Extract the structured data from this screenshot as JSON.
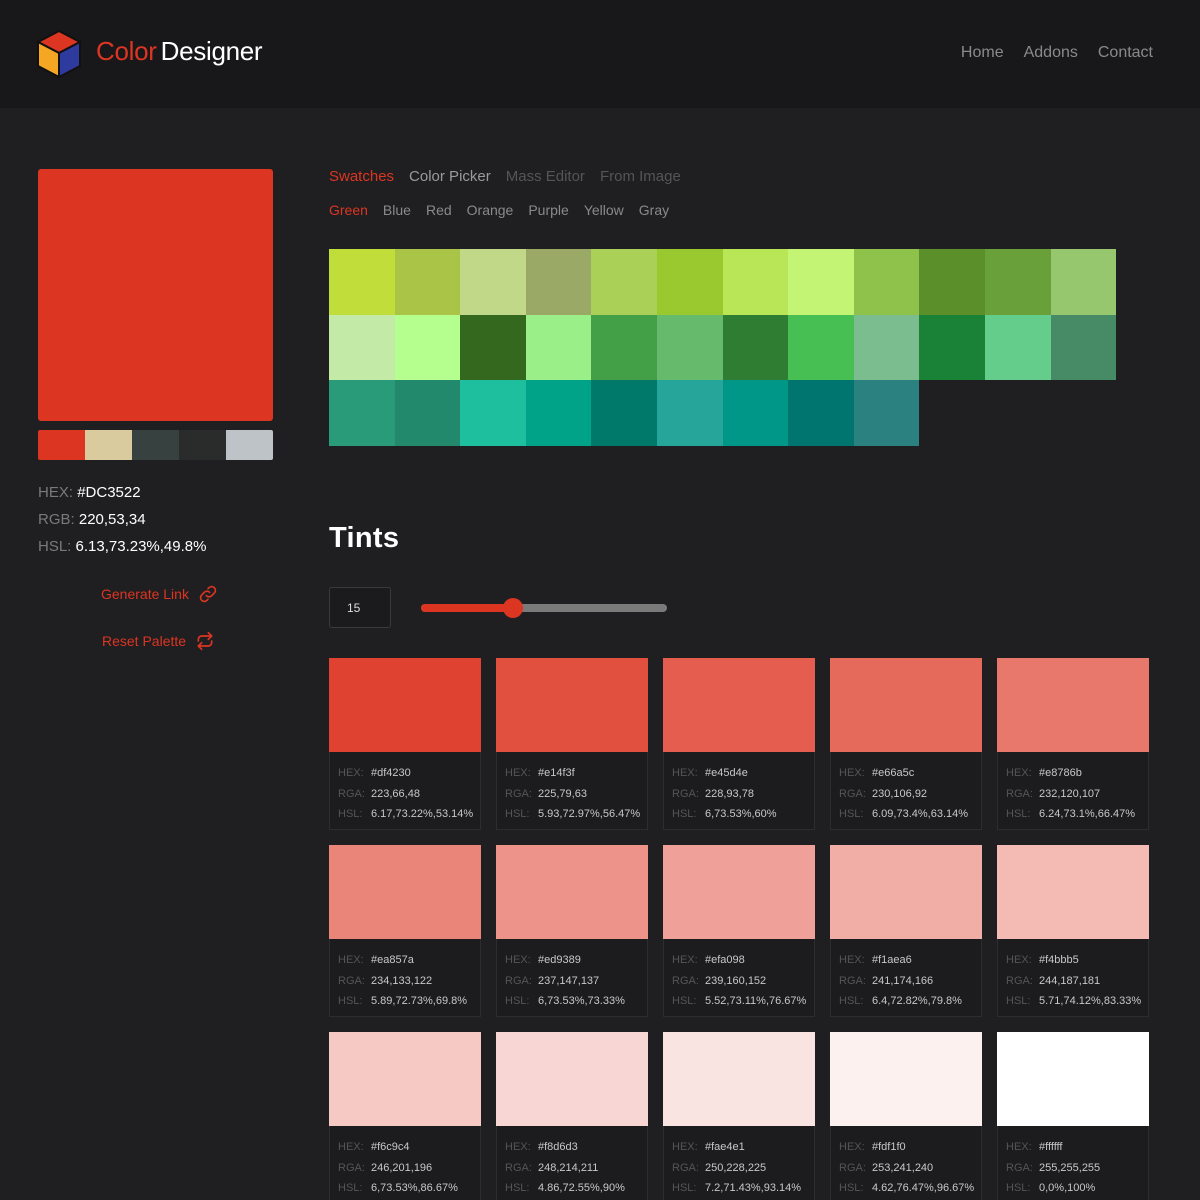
{
  "header": {
    "logo_icon": "cube-logo-icon",
    "brand_part1": "Color",
    "brand_part2": "Designer",
    "nav": [
      {
        "label": "Home"
      },
      {
        "label": "Addons"
      },
      {
        "label": "Contact"
      }
    ]
  },
  "current_color": {
    "hex": "#DC3522",
    "swatch_color": "#dc3522",
    "hex_label": "HEX:",
    "rgb_label": "RGB:",
    "rgb": "220,53,34",
    "hsl_label": "HSL:",
    "hsl": "6.13,73.23%,49.8%"
  },
  "palette": [
    "#dc3522",
    "#d9cb9e",
    "#374140",
    "#2a2c2b",
    "#bdc3c7"
  ],
  "actions": {
    "generate_link": "Generate Link",
    "generate_link_icon": "link-icon",
    "reset_palette": "Reset Palette",
    "reset_palette_icon": "repeat-icon"
  },
  "tabs": [
    {
      "label": "Swatches",
      "state": "active"
    },
    {
      "label": "Color Picker",
      "state": "normal"
    },
    {
      "label": "Mass Editor",
      "state": "disabled"
    },
    {
      "label": "From Image",
      "state": "disabled"
    }
  ],
  "subtabs": [
    {
      "label": "Green",
      "active": true
    },
    {
      "label": "Blue",
      "active": false
    },
    {
      "label": "Red",
      "active": false
    },
    {
      "label": "Orange",
      "active": false
    },
    {
      "label": "Purple",
      "active": false
    },
    {
      "label": "Yellow",
      "active": false
    },
    {
      "label": "Gray",
      "active": false
    }
  ],
  "swatches": [
    "#c0dd3a",
    "#a9c447",
    "#c2d889",
    "#9aaa66",
    "#aad057",
    "#99c92e",
    "#b8e657",
    "#c4f474",
    "#8fc24b",
    "#5a8f2a",
    "#6aa03a",
    "#96c66d",
    "#c3eaa6",
    "#b4ff8e",
    "#34681e",
    "#9bef88",
    "#44a046",
    "#65bb6b",
    "#2e7d33",
    "#47bf53",
    "#7cbd8f",
    "#1a8237",
    "#65cd8c",
    "#468b66",
    "#2a9b79",
    "#22896d",
    "#1dbf9f",
    "#00a388",
    "#00796b",
    "#26a69a",
    "#009688",
    "#00756f",
    "#2b8080"
  ],
  "tints": {
    "title": "Tints",
    "count": "15",
    "slider_value": 15,
    "slider_min": 0,
    "slider_max": 40,
    "labels": {
      "hex": "HEX:",
      "rgb": "RGA:",
      "hsl": "HSL:"
    },
    "items": [
      {
        "hex": "#df4230",
        "rgb": "223,66,48",
        "hsl": "6.17,73.22%,53.14%"
      },
      {
        "hex": "#e14f3f",
        "rgb": "225,79,63",
        "hsl": "5.93,72.97%,56.47%"
      },
      {
        "hex": "#e45d4e",
        "rgb": "228,93,78",
        "hsl": "6,73.53%,60%"
      },
      {
        "hex": "#e66a5c",
        "rgb": "230,106,92",
        "hsl": "6.09,73.4%,63.14%"
      },
      {
        "hex": "#e8786b",
        "rgb": "232,120,107",
        "hsl": "6.24,73.1%,66.47%"
      },
      {
        "hex": "#ea857a",
        "rgb": "234,133,122",
        "hsl": "5.89,72.73%,69.8%"
      },
      {
        "hex": "#ed9389",
        "rgb": "237,147,137",
        "hsl": "6,73.53%,73.33%"
      },
      {
        "hex": "#efa098",
        "rgb": "239,160,152",
        "hsl": "5.52,73.11%,76.67%"
      },
      {
        "hex": "#f1aea6",
        "rgb": "241,174,166",
        "hsl": "6.4,72.82%,79.8%"
      },
      {
        "hex": "#f4bbb5",
        "rgb": "244,187,181",
        "hsl": "5.71,74.12%,83.33%"
      },
      {
        "hex": "#f6c9c4",
        "rgb": "246,201,196",
        "hsl": "6,73.53%,86.67%"
      },
      {
        "hex": "#f8d6d3",
        "rgb": "248,214,211",
        "hsl": "4.86,72.55%,90%"
      },
      {
        "hex": "#fae4e1",
        "rgb": "250,228,225",
        "hsl": "7.2,71.43%,93.14%"
      },
      {
        "hex": "#fdf1f0",
        "rgb": "253,241,240",
        "hsl": "4.62,76.47%,96.67%"
      },
      {
        "hex": "#ffffff",
        "rgb": "255,255,255",
        "hsl": "0,0%,100%"
      }
    ]
  }
}
